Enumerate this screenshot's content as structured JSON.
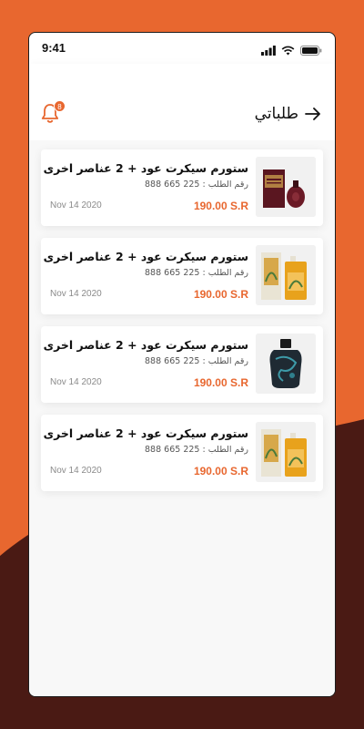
{
  "colors": {
    "accent": "#E8672F",
    "dark_bg": "#4A1A14",
    "card_bg": "#ffffff"
  },
  "status_bar": {
    "time": "9:41",
    "icons": [
      "signal-icon",
      "wifi-icon",
      "battery-icon"
    ]
  },
  "header": {
    "title": "طلباتي",
    "back_icon": "arrow-right-icon",
    "notification_icon": "bell-icon",
    "notification_count": "8"
  },
  "orders": [
    {
      "title": "ستورم سيكرت عود + 2 عناصر اخرى",
      "order_number": "رقم الطلب : 225 665 888",
      "price": "190.00 S.R",
      "date": "Nov 14 2020",
      "image": "perfume-box-maroon"
    },
    {
      "title": "ستورم سيكرت عود + 2 عناصر اخرى",
      "order_number": "رقم الطلب : 225 665 888",
      "price": "190.00 S.R",
      "date": "Nov 14 2020",
      "image": "perfume-box-gold"
    },
    {
      "title": "ستورم سيكرت عود + 2 عناصر اخرى",
      "order_number": "رقم الطلب : 225 665 888",
      "price": "190.00 S.R",
      "date": "Nov 14 2020",
      "image": "perfume-bottle-dark"
    },
    {
      "title": "ستورم سيكرت عود + 2 عناصر اخرى",
      "order_number": "رقم الطلب : 225 665 888",
      "price": "190.00 S.R",
      "date": "Nov 14 2020",
      "image": "perfume-box-gold"
    }
  ]
}
